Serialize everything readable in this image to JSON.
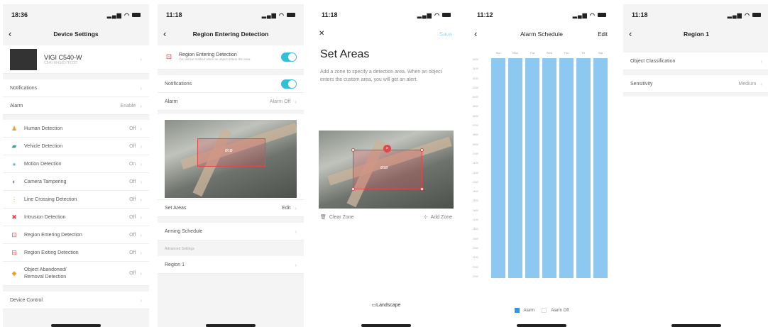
{
  "colors": {
    "accent": "#33bfd8",
    "zone": "#e0484c",
    "schedule": "#8cc8f0",
    "legend_alarm": "#2f95e6"
  },
  "screen1": {
    "time": "18:36",
    "title": "Device Settings",
    "device_name": "VIGI C540-W",
    "device_sub": "C540-W4S6D7FC0D",
    "notifications": "Notifications",
    "alarm_label": "Alarm",
    "alarm_value": "Enable",
    "items": [
      {
        "label": "Human Detection",
        "value": "Off",
        "icon": "human-icon"
      },
      {
        "label": "Vehicle Detection",
        "value": "Off",
        "icon": "vehicle-icon"
      },
      {
        "label": "Motion Detection",
        "value": "On",
        "icon": "motion-icon"
      },
      {
        "label": "Camera Tampering",
        "value": "Off",
        "icon": "tamper-icon"
      },
      {
        "label": "Line Crossing Detection",
        "value": "Off",
        "icon": "line-cross-icon"
      },
      {
        "label": "Intrusion Detection",
        "value": "Off",
        "icon": "intrusion-icon"
      },
      {
        "label": "Region Entering Detection",
        "value": "Off",
        "icon": "region-enter-icon"
      },
      {
        "label": "Region Exiting Detection",
        "value": "Off",
        "icon": "region-exit-icon"
      },
      {
        "label": "Object Abandoned/\nRemoval Detection",
        "value": "Off",
        "icon": "object-icon"
      }
    ],
    "device_control": "Device Control"
  },
  "screen2": {
    "time": "11:18",
    "title": "Region Entering Detection",
    "feature_title": "Region Entering Detection",
    "feature_desc": "You will be notified when an object enters the area.",
    "notifications": "Notifications",
    "alarm_label": "Alarm",
    "alarm_value": "Alarm Off",
    "set_areas": "Set Areas",
    "edit": "Edit",
    "arming": "Arming Schedule",
    "advanced": "Advanced Settings",
    "region": "Region 1",
    "zone_label": "Ø1Ø"
  },
  "screen3": {
    "time": "11:18",
    "save": "Save",
    "heading": "Set Areas",
    "desc": "Add a zone to specify a detection area. When an object enters the custom area, you will get an alert.",
    "clear_zone": "Clear Zone",
    "add_zone": "Add Zone",
    "landscape": "Landscape",
    "zone_label": "Ø1Ø"
  },
  "screen4": {
    "time": "11:12",
    "title": "Alarm Schedule",
    "edit": "Edit",
    "days": [
      "Sun",
      "Mon",
      "Tue",
      "Wed",
      "Thu",
      "Fri",
      "Sat"
    ],
    "hours": [
      "00:00",
      "01:00",
      "02:00",
      "03:00",
      "04:00",
      "05:00",
      "06:00",
      "07:00",
      "08:00",
      "09:00",
      "10:00",
      "11:00",
      "12:00",
      "13:00",
      "14:00",
      "15:00",
      "16:00",
      "17:00",
      "18:00",
      "19:00",
      "20:00",
      "21:00",
      "22:00",
      "23:00"
    ],
    "legend_alarm": "Alarm",
    "legend_off": "Alarm Off"
  },
  "screen5": {
    "time": "11:18",
    "title": "Region 1",
    "object_classification": "Object Classification",
    "sensitivity_label": "Sensitivity",
    "sensitivity_value": "Medium"
  }
}
